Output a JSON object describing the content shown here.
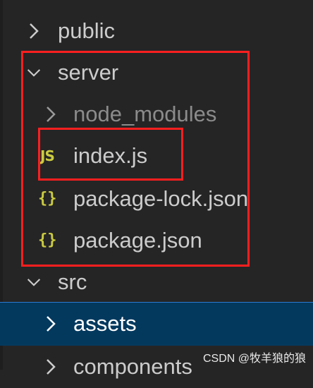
{
  "explorer": {
    "items": [
      {
        "label": "public",
        "icon": "chevron-right-icon"
      },
      {
        "label": "server",
        "icon": "chevron-down-icon"
      },
      {
        "label": "node_modules",
        "icon": "chevron-right-icon"
      },
      {
        "label": "index.js",
        "badge": "JS"
      },
      {
        "label": "package-lock.json",
        "badge": "{}"
      },
      {
        "label": "package.json",
        "badge": "{}"
      },
      {
        "label": "src",
        "icon": "chevron-down-icon"
      },
      {
        "label": "assets",
        "icon": "chevron-right-icon"
      },
      {
        "label": "components",
        "icon": "chevron-right-icon"
      }
    ]
  },
  "watermark": "CSDN @牧羊狼的狼",
  "colors": {
    "background": "#252526",
    "selected_row": "#04395e",
    "annotation_red": "#ff1f1f",
    "badge_yellow": "#cbcb41"
  }
}
